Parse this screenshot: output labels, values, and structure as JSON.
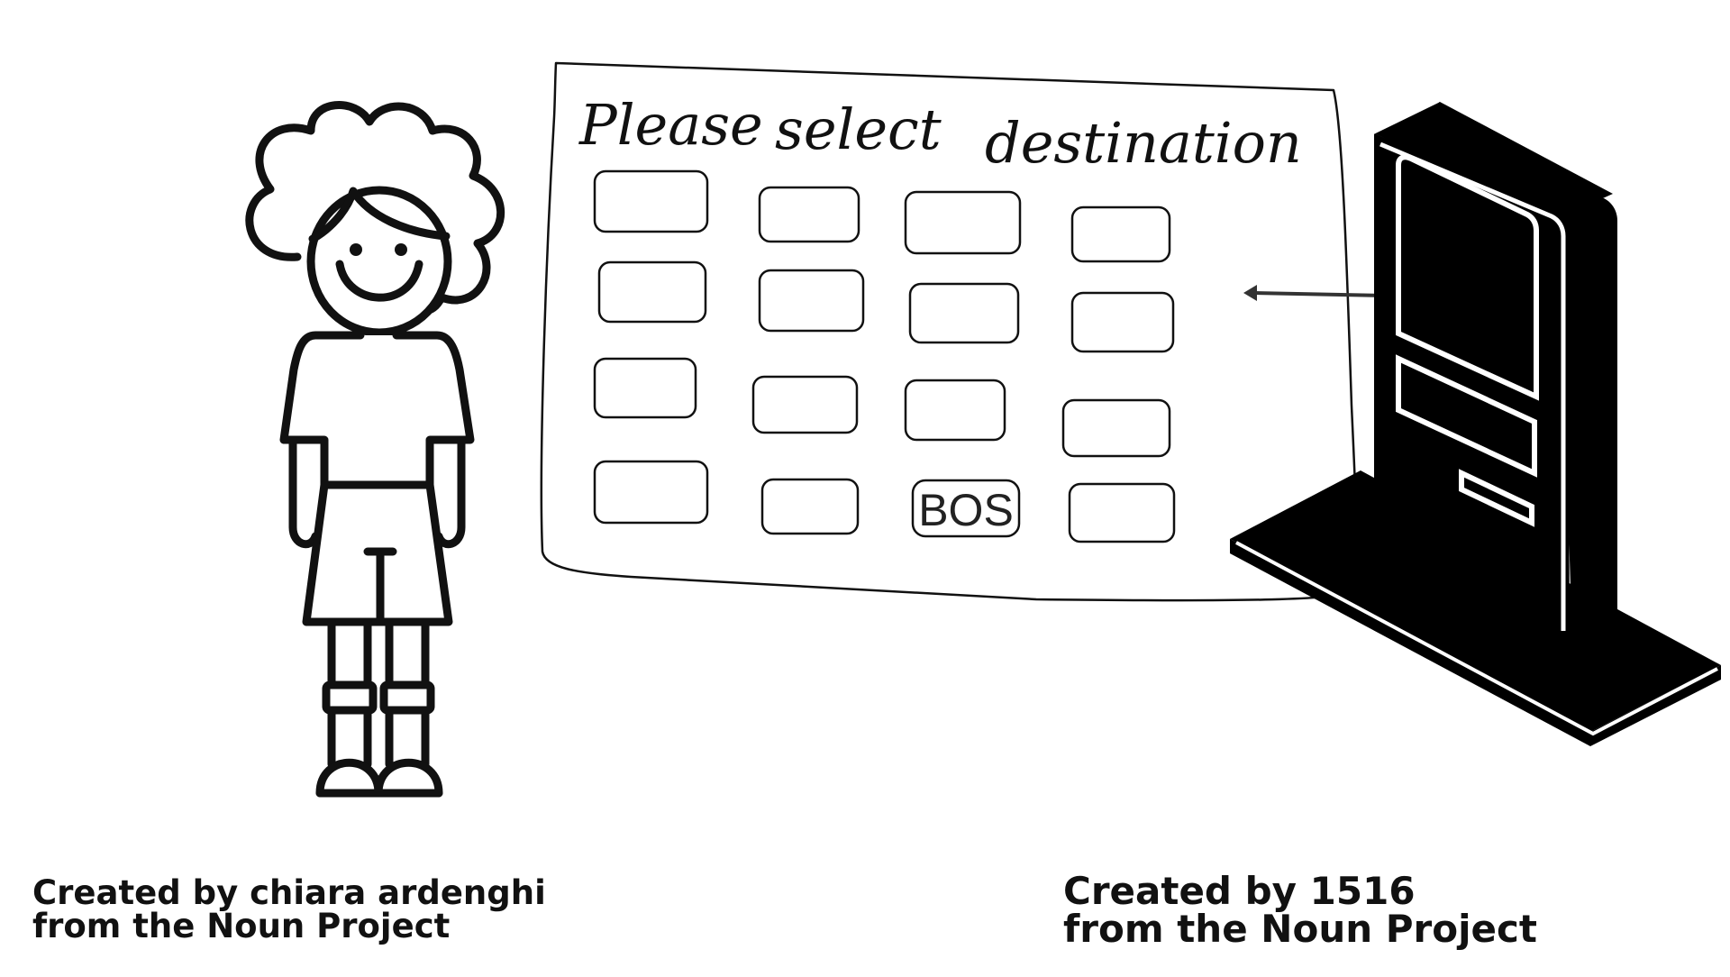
{
  "screen": {
    "heading_words": [
      "Please",
      "select",
      "destination"
    ],
    "selected_button_label": "BOS",
    "grid": {
      "rows": 4,
      "columns": 4,
      "selected_row": 4,
      "selected_column": 3
    }
  },
  "credits": {
    "left": {
      "line1": "Created by chiara ardenghi",
      "line2": "from the Noun Project"
    },
    "right": {
      "line1": "Created by 1516",
      "line2": "from the Noun Project"
    }
  },
  "icons": {
    "person": "person-icon",
    "kiosk": "kiosk-icon",
    "arrow": "arrow-left-icon"
  },
  "colors": {
    "ink": "#111111",
    "background": "#ffffff",
    "kiosk": "#000000"
  }
}
